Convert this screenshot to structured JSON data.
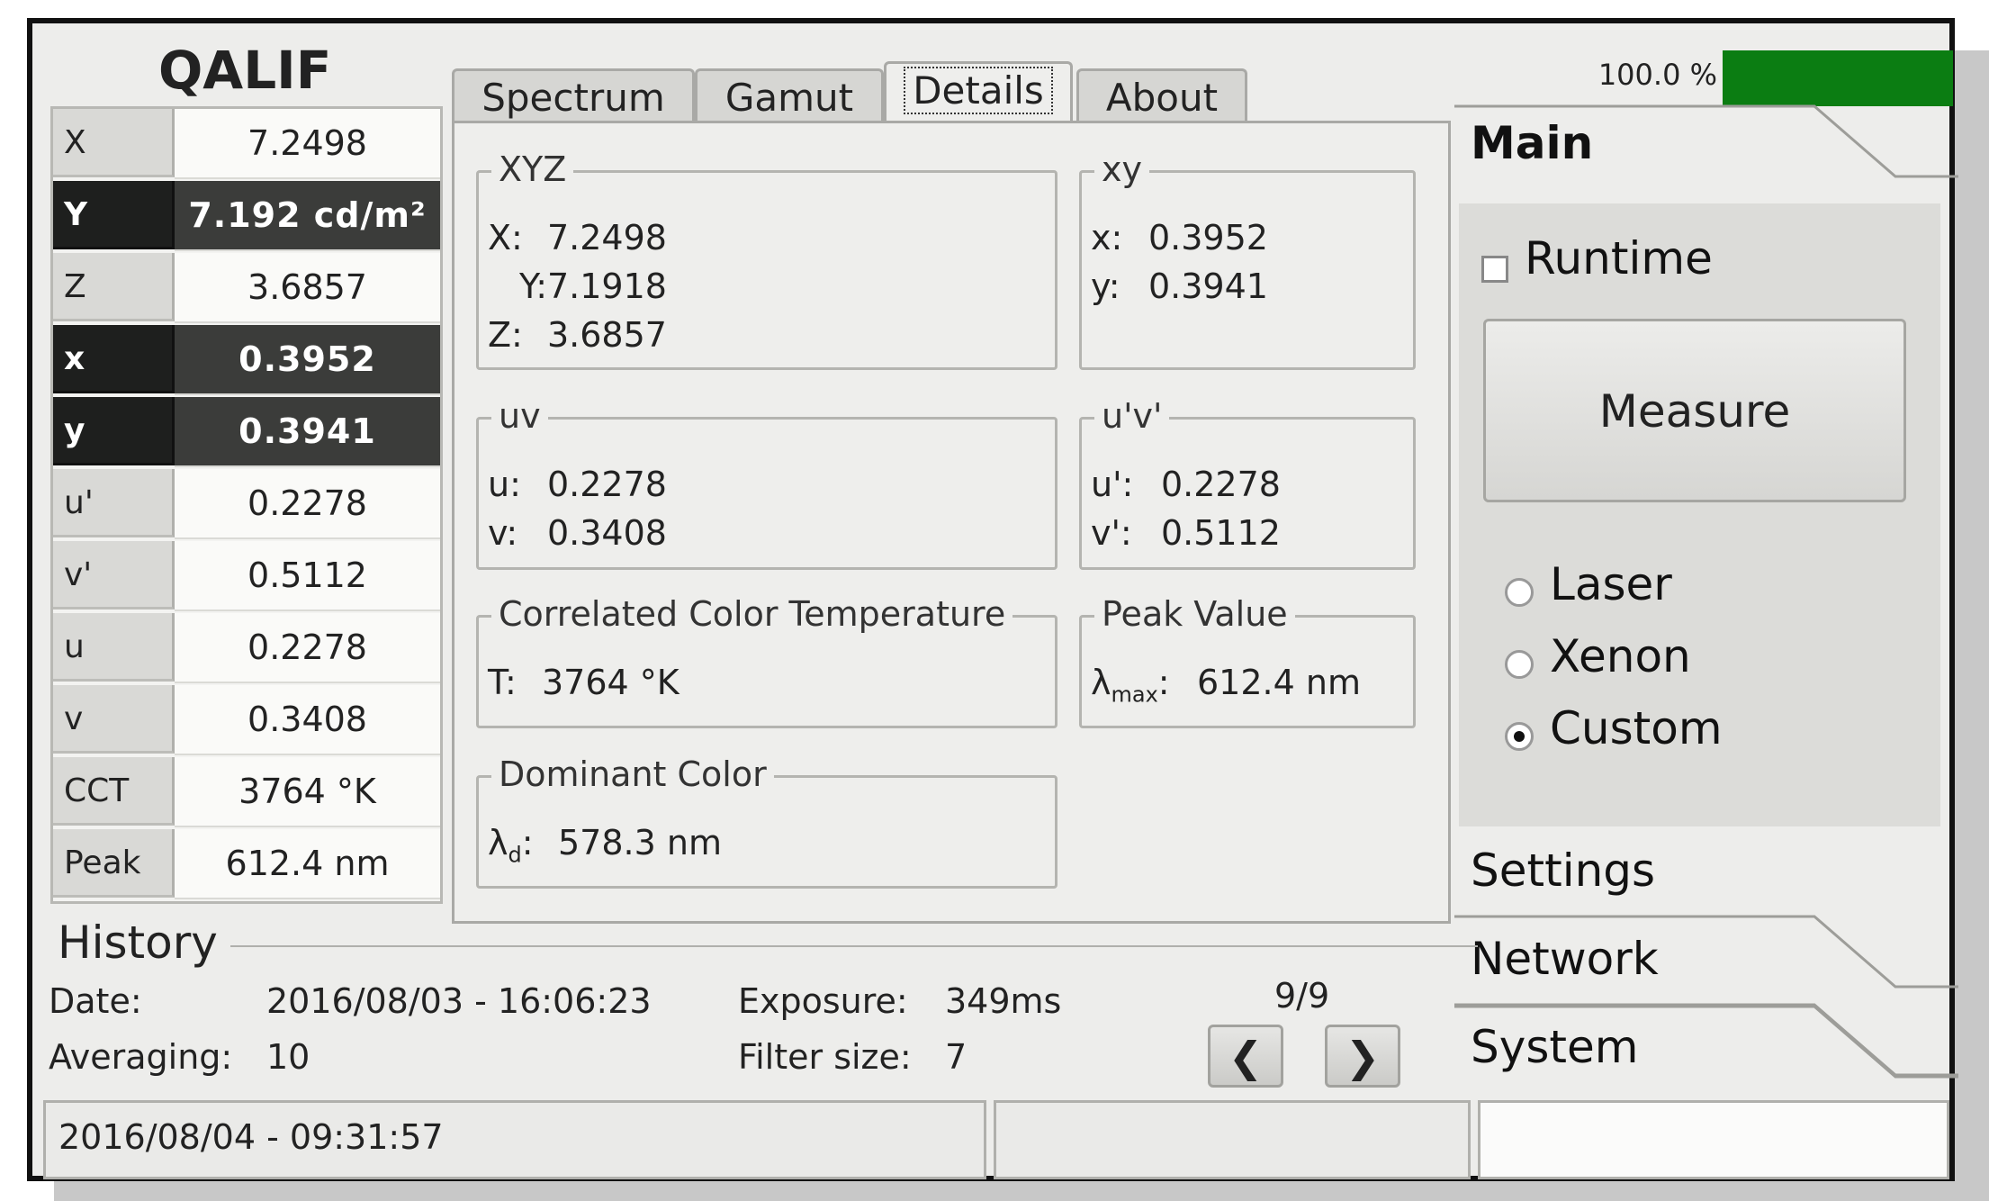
{
  "app": {
    "title": "QALIF"
  },
  "values": [
    {
      "label": "X",
      "value": "7.2498",
      "highlight": false
    },
    {
      "label": "Y",
      "value": "7.192 cd/m²",
      "highlight": true
    },
    {
      "label": "Z",
      "value": "3.6857",
      "highlight": false
    },
    {
      "label": "x",
      "value": "0.3952",
      "highlight": true
    },
    {
      "label": "y",
      "value": "0.3941",
      "highlight": true
    },
    {
      "label": "u'",
      "value": "0.2278",
      "highlight": false
    },
    {
      "label": "v'",
      "value": "0.5112",
      "highlight": false
    },
    {
      "label": "u",
      "value": "0.2278",
      "highlight": false
    },
    {
      "label": "v",
      "value": "0.3408",
      "highlight": false
    },
    {
      "label": "CCT",
      "value": "3764 °K",
      "highlight": false
    },
    {
      "label": "Peak",
      "value": "612.4 nm",
      "highlight": false
    }
  ],
  "tabs": [
    {
      "label": "Spectrum",
      "active": false
    },
    {
      "label": "Gamut",
      "active": false
    },
    {
      "label": "Details",
      "active": true
    },
    {
      "label": "About",
      "active": false
    }
  ],
  "details": {
    "xyz": {
      "title": "XYZ",
      "X_label": "X:",
      "X": "7.2498",
      "Y_label": "Y:",
      "Y": "7.1918",
      "Z_label": "Z:",
      "Z": "3.6857"
    },
    "xy": {
      "title": "xy",
      "x_label": "x:",
      "x": "0.3952",
      "y_label": "y:",
      "y": "0.3941"
    },
    "uv": {
      "title": "uv",
      "u_label": "u:",
      "u": "0.2278",
      "v_label": "v:",
      "v": "0.3408"
    },
    "upvp": {
      "title": "u'v'",
      "u_label": "u':",
      "u": "0.2278",
      "v_label": "v':",
      "v": "0.5112"
    },
    "cct": {
      "title": "Correlated Color Temperature",
      "label": "T:",
      "value": "3764 °K"
    },
    "peak": {
      "title": "Peak Value",
      "label_main": "λ",
      "label_sub": "max",
      "label_colon": ":",
      "value": "612.4 nm"
    },
    "dominant": {
      "title": "Dominant Color",
      "label_main": "λ",
      "label_sub": "d",
      "label_colon": ":",
      "value": "578.3 nm"
    }
  },
  "progress": {
    "label": "100.0 %",
    "fraction": 1.0,
    "color": "#0b7d12"
  },
  "sidebar": {
    "main_title": "Main",
    "runtime_label": "Runtime",
    "runtime_checked": false,
    "measure_label": "Measure",
    "sources": [
      {
        "label": "Laser",
        "selected": false
      },
      {
        "label": "Xenon",
        "selected": false
      },
      {
        "label": "Custom",
        "selected": true
      }
    ],
    "settings": "Settings",
    "network": "Network",
    "system": "System"
  },
  "history": {
    "title": "History",
    "date_label": "Date:",
    "date": "2016/08/03 - 16:06:23",
    "exposure_label": "Exposure:",
    "exposure": "349ms",
    "averaging_label": "Averaging:",
    "averaging": "10",
    "filter_label": "Filter size:",
    "filter": "7",
    "page": "9/9",
    "prev_icon": "❮",
    "next_icon": "❯"
  },
  "status": {
    "datetime": "2016/08/04 - 09:31:57",
    "middle": "",
    "right": ""
  }
}
